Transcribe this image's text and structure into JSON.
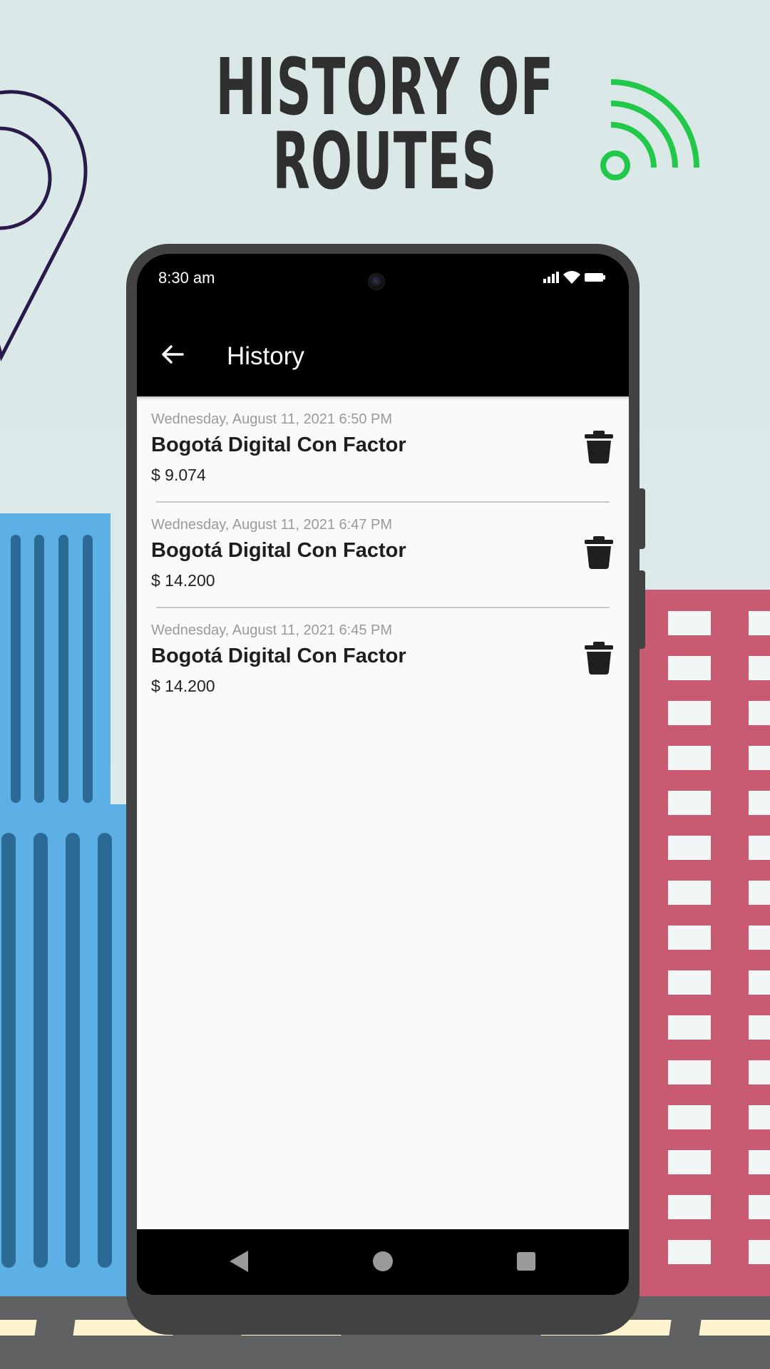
{
  "promo": {
    "headline_line1": "HISTORY OF",
    "headline_line2": "ROUTES"
  },
  "status_bar": {
    "time": "8:30 am",
    "icons": [
      "signal-icon",
      "wifi-icon",
      "battery-icon"
    ]
  },
  "app_bar": {
    "title": "History",
    "back_icon": "arrow-left-icon"
  },
  "history": {
    "items": [
      {
        "date": "Wednesday, August 11, 2021 6:50 PM",
        "title": "Bogotá Digital Con Factor",
        "price": "$ 9.074"
      },
      {
        "date": "Wednesday, August 11, 2021 6:47 PM",
        "title": "Bogotá Digital Con Factor",
        "price": "$ 14.200"
      },
      {
        "date": "Wednesday, August 11, 2021 6:45 PM",
        "title": "Bogotá Digital Con Factor",
        "price": "$ 14.200"
      }
    ],
    "delete_icon": "trash-icon"
  },
  "nav_bar": {
    "buttons": [
      "back-triangle-icon",
      "home-circle-icon",
      "recents-square-icon"
    ]
  },
  "colors": {
    "background": "#dbe9e9",
    "accent_green": "#22c84a",
    "pin_outline": "#2a1a4a",
    "building_blue": "#5cb0e6",
    "building_red": "#c85a72",
    "phone_frame": "#424242",
    "app_bar": "#000000",
    "list_background": "#f9fafa"
  }
}
